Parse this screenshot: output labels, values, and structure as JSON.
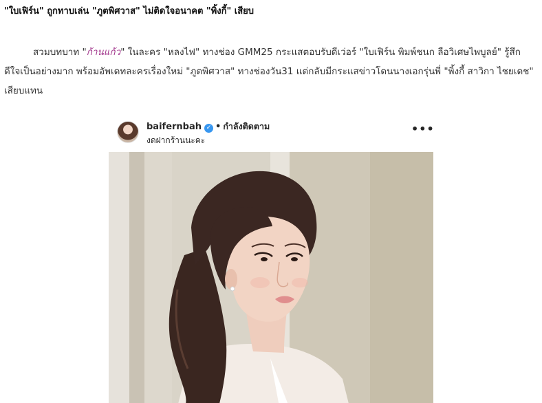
{
  "article": {
    "headline": "\"ใบเฟิร์น\" ถูกทาบเล่น \"ภูตพิศวาส\" ไม่ติดใจอนาคต \"พิ้งกี้\" เสียบ",
    "lead_part1": "สวมบทบาท \"",
    "lead_link": "ก้านแก้ว",
    "lead_part2": "\" ในละคร \"หลงไฟ\" ทางช่อง GMM25 กระแสตอบรับดีเว่อร์ \"ใบเฟิร์น พิมพ์ชนก ลือวิเศษไพบูลย์\" รู้สึกดีใจเป็นอย่างมาก พร้อมอัพเดทละครเรื่องใหม่ \"ภูตพิศวาส\" ทางช่องวัน31 แต่กลับมีกระแสข่าวโดนนางเอกรุ่นพี่ \"พิ้งกี้ สาวิกา ไชยเดช\" เสียบแทน"
  },
  "instagram": {
    "username": "baifernbah",
    "verified_mark": "✓",
    "separator": "•",
    "follow_status": "กำลังติดตาม",
    "location": "งดฝากร้านนะคะ",
    "more_glyph": "•••",
    "icons": {
      "verified": "verified-badge-icon",
      "more": "more-options-icon"
    },
    "colors": {
      "verified": "#3897f0",
      "link": "#a0338a"
    }
  }
}
